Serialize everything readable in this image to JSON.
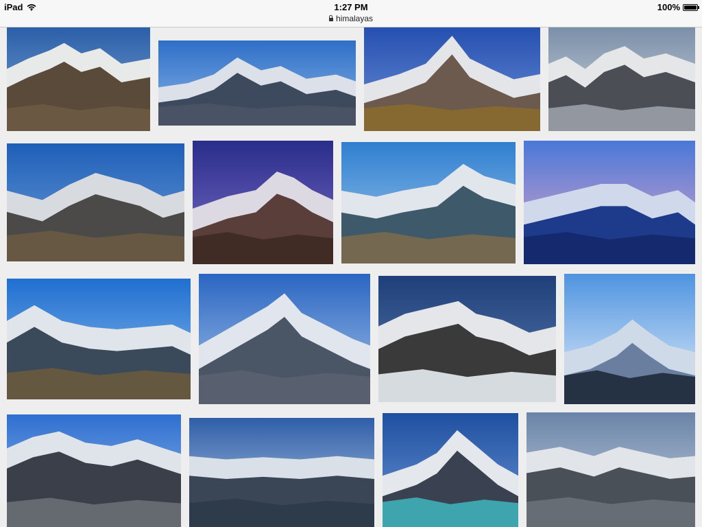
{
  "status_bar": {
    "device": "iPad",
    "time": "1:27 PM",
    "battery": "100%"
  },
  "address_bar": {
    "url": "himalayas"
  },
  "icons": {
    "wifi": "wifi-icon",
    "lock": "lock-icon",
    "battery": "battery-icon"
  },
  "colors": {
    "page_background": "#eeeeee",
    "status_bar_background": "#f7f7f7"
  },
  "image_results": [
    {
      "sky": [
        "#2b5fa8",
        "#7fa7d6"
      ],
      "snow": "#f4f6f9",
      "rock": "#5a4a3a",
      "ground": "#6b5a44"
    },
    {
      "sky": [
        "#2e6fc7",
        "#8cb6e8"
      ],
      "snow": "#e9eef5",
      "rock": "#3d4a5e",
      "ground": "#4a5466"
    },
    {
      "sky": [
        "#2650b0",
        "#6a8fd8"
      ],
      "snow": "#eef1f6",
      "rock": "#6c5a4e",
      "ground": "#8a6a2e"
    },
    {
      "sky": [
        "#7b8fa8",
        "#d4dbe4"
      ],
      "snow": "#f2f3f5",
      "rock": "#4b4e55",
      "ground": "#9aa0a8"
    },
    {
      "sky": [
        "#1f5fb8",
        "#6f9fd8"
      ],
      "snow": "#e3e7ee",
      "rock": "#4b4a48",
      "ground": "#6a5a44"
    },
    {
      "sky": [
        "#2a2d8a",
        "#7a6fc8"
      ],
      "snow": "#e8e6f2",
      "rock": "#5a3e3a",
      "ground": "#3e2a24"
    },
    {
      "sky": [
        "#2f7fd0",
        "#a5cbee"
      ],
      "snow": "#eef2f6",
      "rock": "#3e5a6a",
      "ground": "#7a6a4e"
    },
    {
      "sky": [
        "#4a78d8",
        "#e6a8c8"
      ],
      "snow": "#e0e6f4",
      "rock": "#1e3a8a",
      "ground": "#14286a"
    },
    {
      "sky": [
        "#1f6fd0",
        "#8fbfee"
      ],
      "snow": "#eef2f6",
      "rock": "#3a4a5a",
      "ground": "#6a5a3e"
    },
    {
      "sky": [
        "#2b66c2",
        "#a8c6ea"
      ],
      "snow": "#eef2f8",
      "rock": "#4a5566",
      "ground": "#5a6270"
    },
    {
      "sky": [
        "#1f3f7a",
        "#5a7cb0"
      ],
      "snow": "#f3f5f8",
      "rock": "#3a3a3a",
      "ground": "#e8edf3"
    },
    {
      "sky": [
        "#4f94e0",
        "#e6f0fa"
      ],
      "snow": "#d8e2ef",
      "rock": "#6a7fa0",
      "ground": "#1e2a3a"
    },
    {
      "sky": [
        "#2e6fd0",
        "#9ec2ee"
      ],
      "snow": "#eef2f7",
      "rock": "#3a3f4a",
      "ground": "#6a6e74"
    },
    {
      "sky": [
        "#2f5ea8",
        "#b8cde4"
      ],
      "snow": "#e8eef4",
      "rock": "#3a4556",
      "ground": "#2e3a4a"
    },
    {
      "sky": [
        "#1f4fa0",
        "#6a96d6"
      ],
      "snow": "#f3f5f8",
      "rock": "#3a4150",
      "ground": "#3fb0b8"
    },
    {
      "sky": [
        "#6a84a8",
        "#c8d4e2"
      ],
      "snow": "#eef1f4",
      "rock": "#4a5058",
      "ground": "#6a7078"
    }
  ]
}
